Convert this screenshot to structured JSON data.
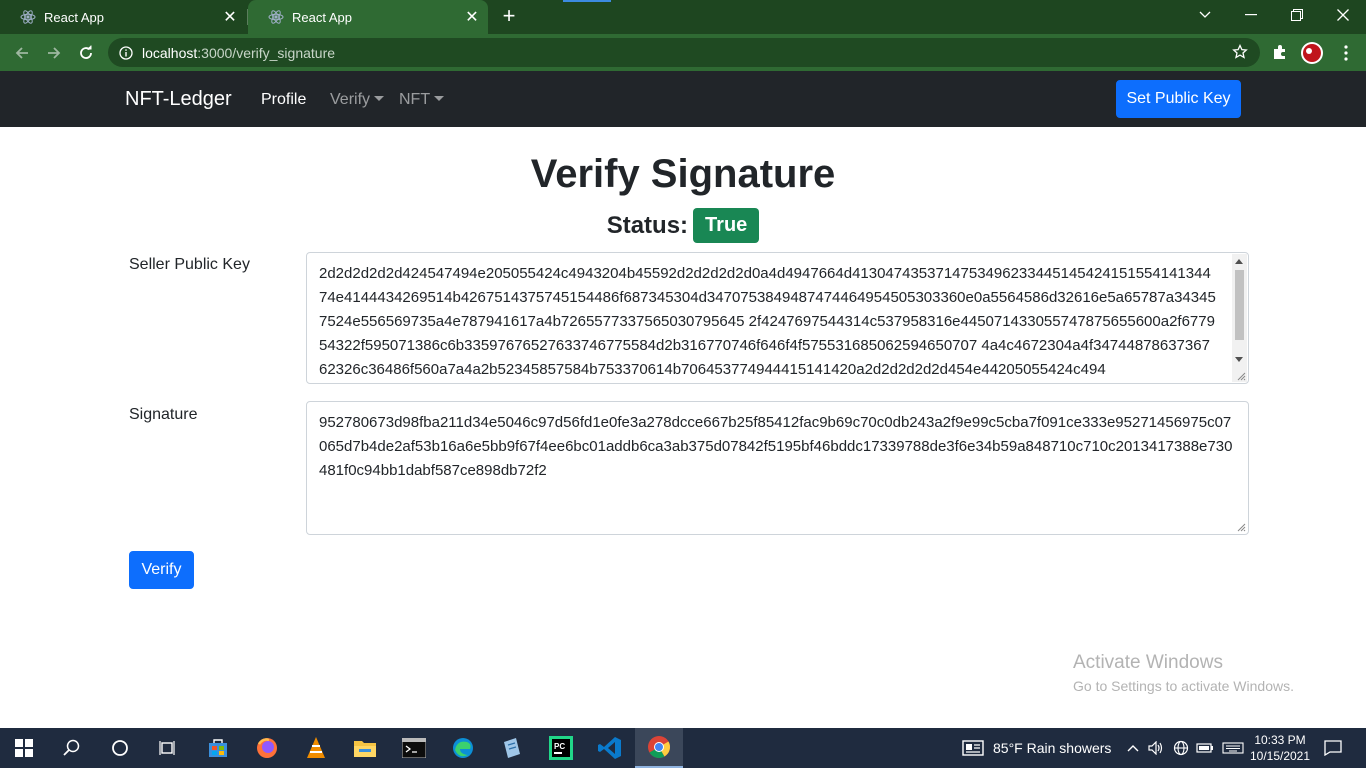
{
  "browser": {
    "tabs": [
      {
        "title": "React App",
        "icon": "react-icon"
      },
      {
        "title": "React App",
        "icon": "react-icon"
      }
    ],
    "new_tab": "+",
    "url_host": "localhost",
    "url_path": ":3000/verify_signature"
  },
  "navbar": {
    "brand": "NFT-Ledger",
    "links": [
      "Profile",
      "Verify",
      "NFT"
    ],
    "set_key_button": "Set Public Key"
  },
  "page": {
    "title": "Verify Signature",
    "status_label": "Status:",
    "status_value": "True",
    "status_color": "#198754",
    "public_key_label": "Seller Public Key",
    "public_key_value": "2d2d2d2d2d424547494e205055424c4943204b45592d2d2d2d2d0a4d4947664d413047435371475349623344514542415155414134474e4144434269514b4267514375745154486f687345304d3470753849487474464954505303360e0a5564586d32616e5a65787a343457524e556569735a4e787941617a4b7265577337565030795645 2f4247697544314c537958316e445071433055747875655600a2f677954322f595071386c6b33597676527633746775584d2b316770746f646f4f575531685062594650707 4a4c4672304a4f3474487863736762326c36486f560a7a4a2b52345857584b753370614b706453774944415141420a2d2d2d2d2d454e44205055424c494",
    "signature_label": "Signature",
    "signature_value": "952780673d98fba211d34e5046c97d56fd1e0fe3a278dcce667b25f85412fac9b69c70c0db243a2f9e99c5cba7f091ce333e95271456975c07065d7b4de2af53b16a6e5bb9f67f4ee6bc01addb6ca3ab375d07842f5195bf46bddc17339788de3f6e34b59a848710c710c2013417388e730481f0c94bb1dabf587ce898db72f2",
    "verify_button": "Verify",
    "accent_color": "#0d6efd"
  },
  "watermark": {
    "line1": "Activate Windows",
    "line2": "Go to Settings to activate Windows."
  },
  "taskbar": {
    "weather": "85°F  Rain showers",
    "time": "10:33 PM",
    "date": "10/15/2021"
  }
}
